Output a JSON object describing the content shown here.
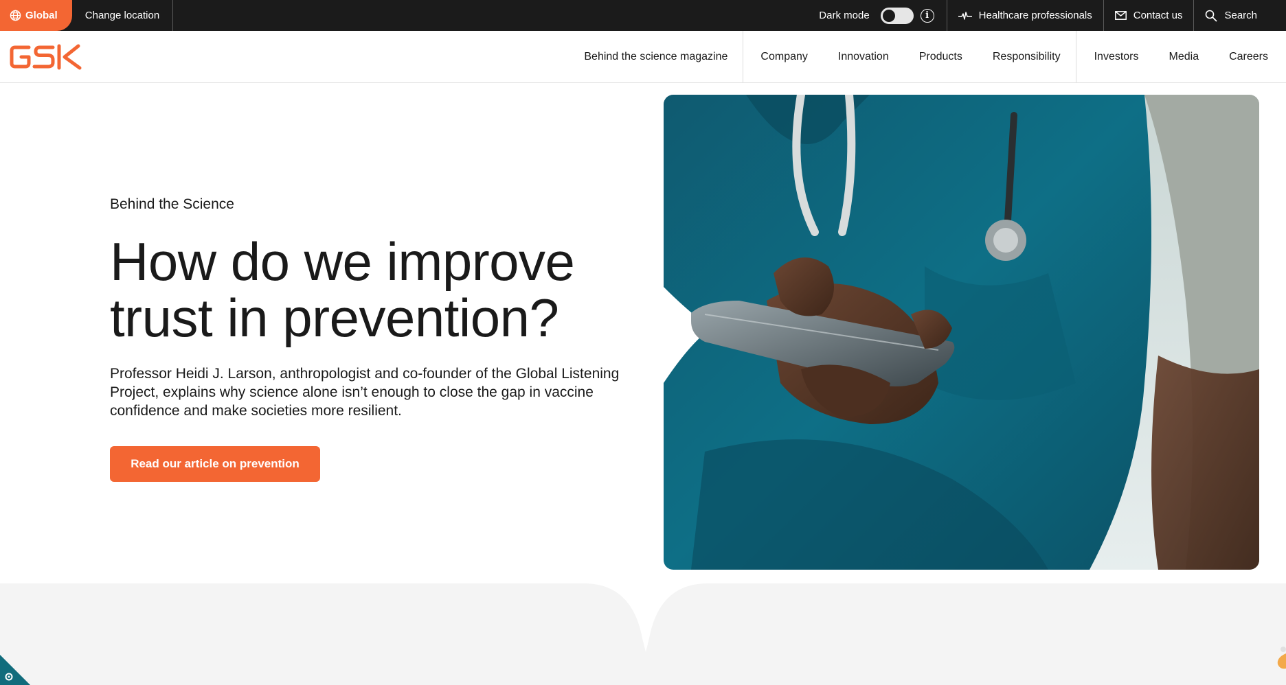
{
  "utility_bar": {
    "global_label": "Global",
    "change_location_label": "Change location",
    "dark_mode_label": "Dark mode",
    "healthcare_label": "Healthcare professionals",
    "contact_label": "Contact us",
    "search_label": "Search"
  },
  "brand": {
    "logo_text": "GSK",
    "accent_color": "#f36633",
    "dark_bar_color": "#1b1b1b"
  },
  "nav": {
    "items": [
      {
        "label": "Behind the science magazine"
      },
      {
        "label": "Company"
      },
      {
        "label": "Innovation"
      },
      {
        "label": "Products"
      },
      {
        "label": "Responsibility"
      },
      {
        "label": "Investors"
      },
      {
        "label": "Media"
      },
      {
        "label": "Careers"
      }
    ]
  },
  "hero": {
    "eyebrow": "Behind the Science",
    "headline": "How do we improve trust in prevention?",
    "lede": "Professor Heidi J. Larson, anthropologist and co-founder of the Global Listening Project, explains why science alone isn’t enough to close the gap in vaccine confidence and make societies more resilient.",
    "cta_label": "Read our article on prevention"
  },
  "icons": {
    "globe": "globe-icon",
    "info": "info-icon",
    "pulse": "pulse-icon",
    "mail": "mail-icon",
    "search": "search-icon",
    "cookie": "gear-icon"
  }
}
